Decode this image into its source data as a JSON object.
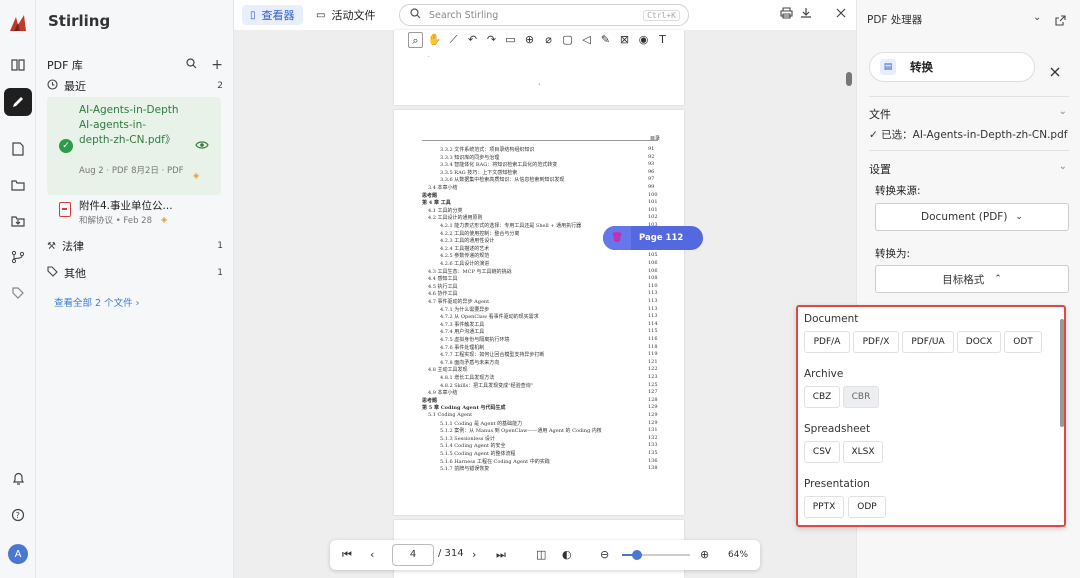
{
  "app": {
    "brand": "Stirling"
  },
  "rail": {
    "icons": [
      "logo-icon",
      "book-icon",
      "pen-icon",
      "file-icon",
      "folder-icon",
      "folder-in-icon",
      "branch-icon",
      "tag-icon",
      "bell-icon",
      "help-icon"
    ],
    "avatar_letter": "A"
  },
  "library": {
    "title": "PDF 库",
    "recent_label": "最近",
    "recent_count": "2",
    "file1": {
      "name_line1": "AI-Agents-in-Depth",
      "name_line2": "AI-agents-in-depth-zh-CN.pdf》",
      "meta": "Aug 2 · PDF 8月2日 · PDF"
    },
    "file2": {
      "name": "附件4.事业单位公...",
      "meta": "和解协议 • Feb 28"
    },
    "law_label": "法律",
    "law_count": "1",
    "other_label": "其他",
    "other_count": "1",
    "view_all": "查看全部 2 个文件"
  },
  "topbar": {
    "tab_viewer": "查看器",
    "tab_files": "活动文件",
    "search_placeholder": "Search Stirling",
    "search_shortcut": "Ctrl+K"
  },
  "viewer": {
    "page_pill": "Page 112",
    "page_header": "目录",
    "current_page": "4",
    "total_pages": "/ 314",
    "zoom": "64%",
    "zoom_fraction": 0.64,
    "toc_lines": [
      [
        "3.3.2 文件系统范式：项目录结构组织知识",
        "91"
      ],
      [
        "3.3.3 知识库的同步与治理",
        "92"
      ],
      [
        "3.3.4 智能体化 RAG：将知识检索工具化的范式转变",
        "93"
      ],
      [
        "3.3.5 RAG 技巧：上下文感知检索",
        "96"
      ],
      [
        "3.3.6 从数据集中检索高质知识：从信息检索到知识发现",
        "97"
      ],
      [
        "3.4 本章小结",
        "99"
      ],
      [
        "思考题",
        "100"
      ],
      [
        "第 4 章 工具",
        "101"
      ],
      [
        "4.1 工具的分类",
        "101"
      ],
      [
        "4.2 工具设计的通用原则",
        "102"
      ],
      [
        "4.2.1 能力表达形式的选择：专用工具还是 Shell + 通用执行器",
        "103"
      ],
      [
        "4.2.2 工具的使用控制：整合与分离",
        "104"
      ],
      [
        "4.2.3 工具的通用性设计",
        "104"
      ],
      [
        "4.2.4 工具描述的艺术",
        "104"
      ],
      [
        "4.2.5 参数传递的规范",
        "105"
      ],
      [
        "4.2.6 工具设计的演进",
        "106"
      ],
      [
        "4.3 工具生态：MCP 与工具链的挑战",
        "106"
      ],
      [
        "4.4 感知工具",
        "108"
      ],
      [
        "4.5 执行工具",
        "110"
      ],
      [
        "4.6 协作工具",
        "113"
      ],
      [
        "4.7 事件驱动的异步 Agent",
        "113"
      ],
      [
        "4.7.1 为什么需要异步",
        "113"
      ],
      [
        "4.7.2 从 OpenClaw 看事件驱动的现实需求",
        "113"
      ],
      [
        "4.7.3 事件触发工具",
        "114"
      ],
      [
        "4.7.4 用户沟通工具",
        "115"
      ],
      [
        "4.7.5 虚拟身份与隔离执行环境",
        "116"
      ],
      [
        "4.7.6 事件处理机制",
        "118"
      ],
      [
        "4.7.7 工程实现：如何让回合模型支持异步打断",
        "119"
      ],
      [
        "4.7.8 面向矛盾与未来方向",
        "121"
      ],
      [
        "4.8 主动工具发现",
        "122"
      ],
      [
        "4.8.1 增长工具发现方法",
        "123"
      ],
      [
        "4.8.2 Skills：把工具发现变成“经验查询”",
        "125"
      ],
      [
        "4.9 本章小结",
        "127"
      ],
      [
        "思考题",
        "128"
      ],
      [
        "第 5 章 Coding Agent 与代码生成",
        "129"
      ],
      [
        "5.1 Coding Agent",
        "129"
      ],
      [
        "5.1.1 Coding 是 Agent 的基础能力",
        "129"
      ],
      [
        "5.1.2 案例：从 Manus 到 OpenClaw——通用 Agent 的 Coding 内核",
        "131"
      ],
      [
        "5.1.3 Sessionless 设计",
        "132"
      ],
      [
        "5.1.4 Coding Agent 的安全",
        "133"
      ],
      [
        "5.1.5 Coding Agent 的整体流程",
        "135"
      ],
      [
        "5.1.6 Harness 工程在 Coding Agent 中的实践",
        "136"
      ],
      [
        "5.1.7 前牌与错误恢复",
        "138"
      ]
    ]
  },
  "right_panel": {
    "title": "PDF 处理器",
    "tool_name": "转换",
    "files_label": "文件",
    "selected_file": "✓ 已选：AI-Agents-in-Depth-zh-CN.pdf",
    "settings_label": "设置",
    "from_label": "转换来源:",
    "from_value": "Document (PDF)",
    "to_label": "转换为:",
    "to_value": "目标格式"
  },
  "format_menu": {
    "groups": [
      {
        "name": "Document",
        "items": [
          "PDF/A",
          "PDF/X",
          "PDF/UA",
          "DOCX",
          "ODT"
        ]
      },
      {
        "name": "Archive",
        "items": [
          "CBZ",
          "CBR"
        ]
      },
      {
        "name": "Spreadsheet",
        "items": [
          "CSV",
          "XLSX"
        ]
      },
      {
        "name": "Presentation",
        "items": [
          "PPTX",
          "ODP"
        ]
      }
    ],
    "highlight_color": "#e04848"
  }
}
